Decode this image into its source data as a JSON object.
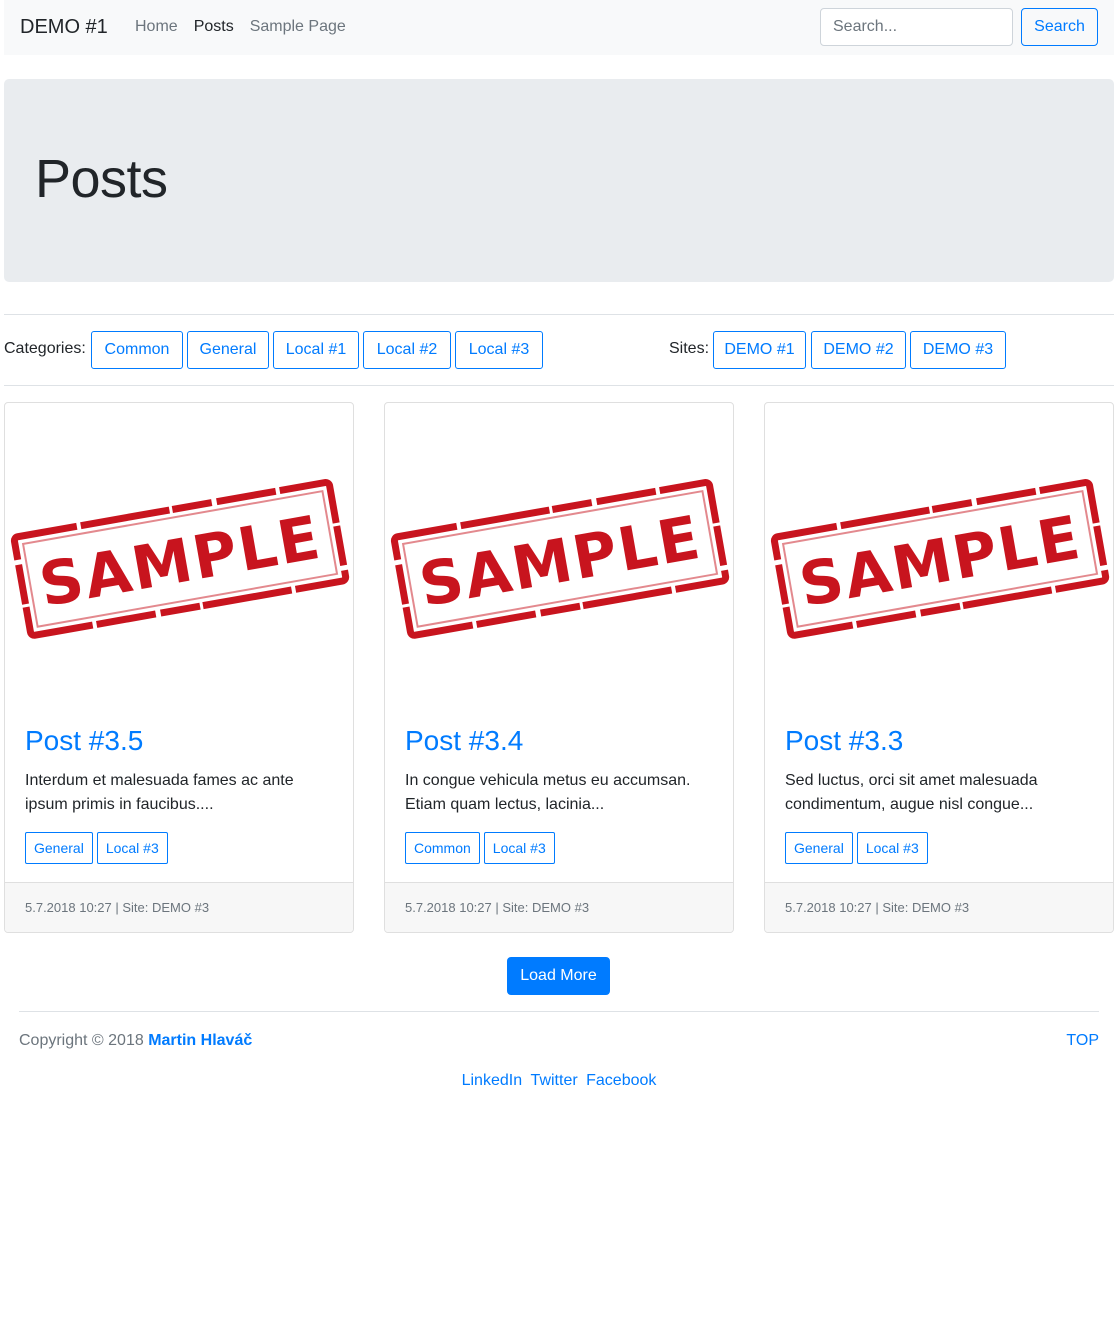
{
  "navbar": {
    "brand": "DEMO #1",
    "links": [
      {
        "label": "Home",
        "active": false
      },
      {
        "label": "Posts",
        "active": true
      },
      {
        "label": "Sample Page",
        "active": false
      }
    ],
    "search_placeholder": "Search...",
    "search_button": "Search"
  },
  "jumbotron": {
    "title": "Posts"
  },
  "filters": {
    "categories_label": "Categories:",
    "categories": [
      "Common",
      "General",
      "Local #1",
      "Local #2",
      "Local #3"
    ],
    "sites_label": "Sites:",
    "sites": [
      "DEMO #1",
      "DEMO #2",
      "DEMO #3"
    ]
  },
  "posts": [
    {
      "image_text": "SAMPLE",
      "title": "Post #3.5",
      "excerpt": "Interdum et malesuada fames ac ante ipsum primis in faucibus....",
      "tags": [
        "General",
        "Local #3"
      ],
      "footer": "5.7.2018 10:27 | Site: DEMO #3"
    },
    {
      "image_text": "SAMPLE",
      "title": "Post #3.4",
      "excerpt": "In congue vehicula metus eu accumsan. Etiam quam lectus, lacinia...",
      "tags": [
        "Common",
        "Local #3"
      ],
      "footer": "5.7.2018 10:27 | Site: DEMO #3"
    },
    {
      "image_text": "SAMPLE",
      "title": "Post #3.3",
      "excerpt": "Sed luctus, orci sit amet malesuada condimentum, augue nisl congue...",
      "tags": [
        "General",
        "Local #3"
      ],
      "footer": "5.7.2018 10:27 | Site: DEMO #3"
    }
  ],
  "load_more": "Load More",
  "footer": {
    "copyright_prefix": "Copyright © 2018",
    "author": "Martin Hlaváč",
    "top_link": "TOP",
    "social": [
      "LinkedIn",
      "Twitter",
      "Facebook"
    ]
  },
  "colors": {
    "primary": "#007bff",
    "stamp_red": "#c8141e",
    "navbar_bg": "#f8f9fa",
    "jumbotron_bg": "#e9ecef"
  }
}
